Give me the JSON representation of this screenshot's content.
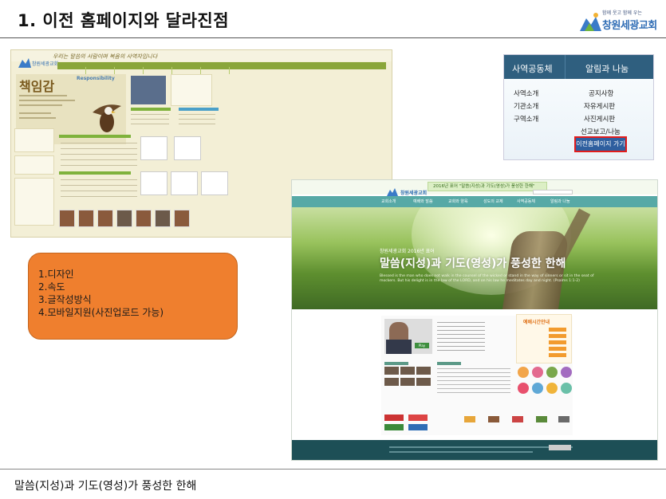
{
  "slide": {
    "title": "1. 이전 홈페이지와 달라진점",
    "caption": "말씀(지성)과 기도(영성)가 풍성한 한해"
  },
  "logo": {
    "tagline": "함께 웃고 함께 우는",
    "name": "창원세광교회"
  },
  "old_site": {
    "slogan": "우리는 말씀의 사람이며 복음의 사역자입니다",
    "logo_text": "창원세광교회",
    "hero_title": "책임감",
    "hero_subtitle": "Responsibility"
  },
  "menu_shot": {
    "header": [
      "사역공동체",
      "알림과 나눔"
    ],
    "left_items": [
      "사역소개",
      "기관소개",
      "구역소개"
    ],
    "right_items": [
      "공지사항",
      "자유게시판",
      "사진게시판",
      "선교보고/나눔"
    ],
    "highlight_link": "이전홈페이지 가기"
  },
  "new_site": {
    "logo_text": "창원세광교회",
    "year_banner": "2016년 표어 \"말씀(지성)과 기도(영성)가 풍성한 한해\"",
    "nav": [
      "교회소개",
      "예배와 말씀",
      "교회와 양육",
      "성도의 교제",
      "사역공동체",
      "알림과 나눔"
    ],
    "banner_small": "창원세광교회 2016년 표어",
    "banner_big": "말씀(지성)과 기도(영성)가 풍성한 한해",
    "banner_verse": "Blessed is the man who does not walk in the counsel of the wicked or stand in the way of sinners or sit in the seat of mockers. But his delight is in the law of the LORD, and on his law he meditates day and night. (Psalms 1:1-2)",
    "worship_title": "예배시간안내",
    "play_label": "Play"
  },
  "note": {
    "items": [
      "1.디자인",
      "2.속도",
      "3.글작성방식",
      "4.모바일지원(사진업로드 가능)"
    ]
  },
  "colors": {
    "orange": "#ef7f2e",
    "highlight_red": "#e21c1c",
    "menu_header": "#2f5f7f",
    "new_nav": "#57a9a6",
    "footer": "#1d4f56"
  }
}
